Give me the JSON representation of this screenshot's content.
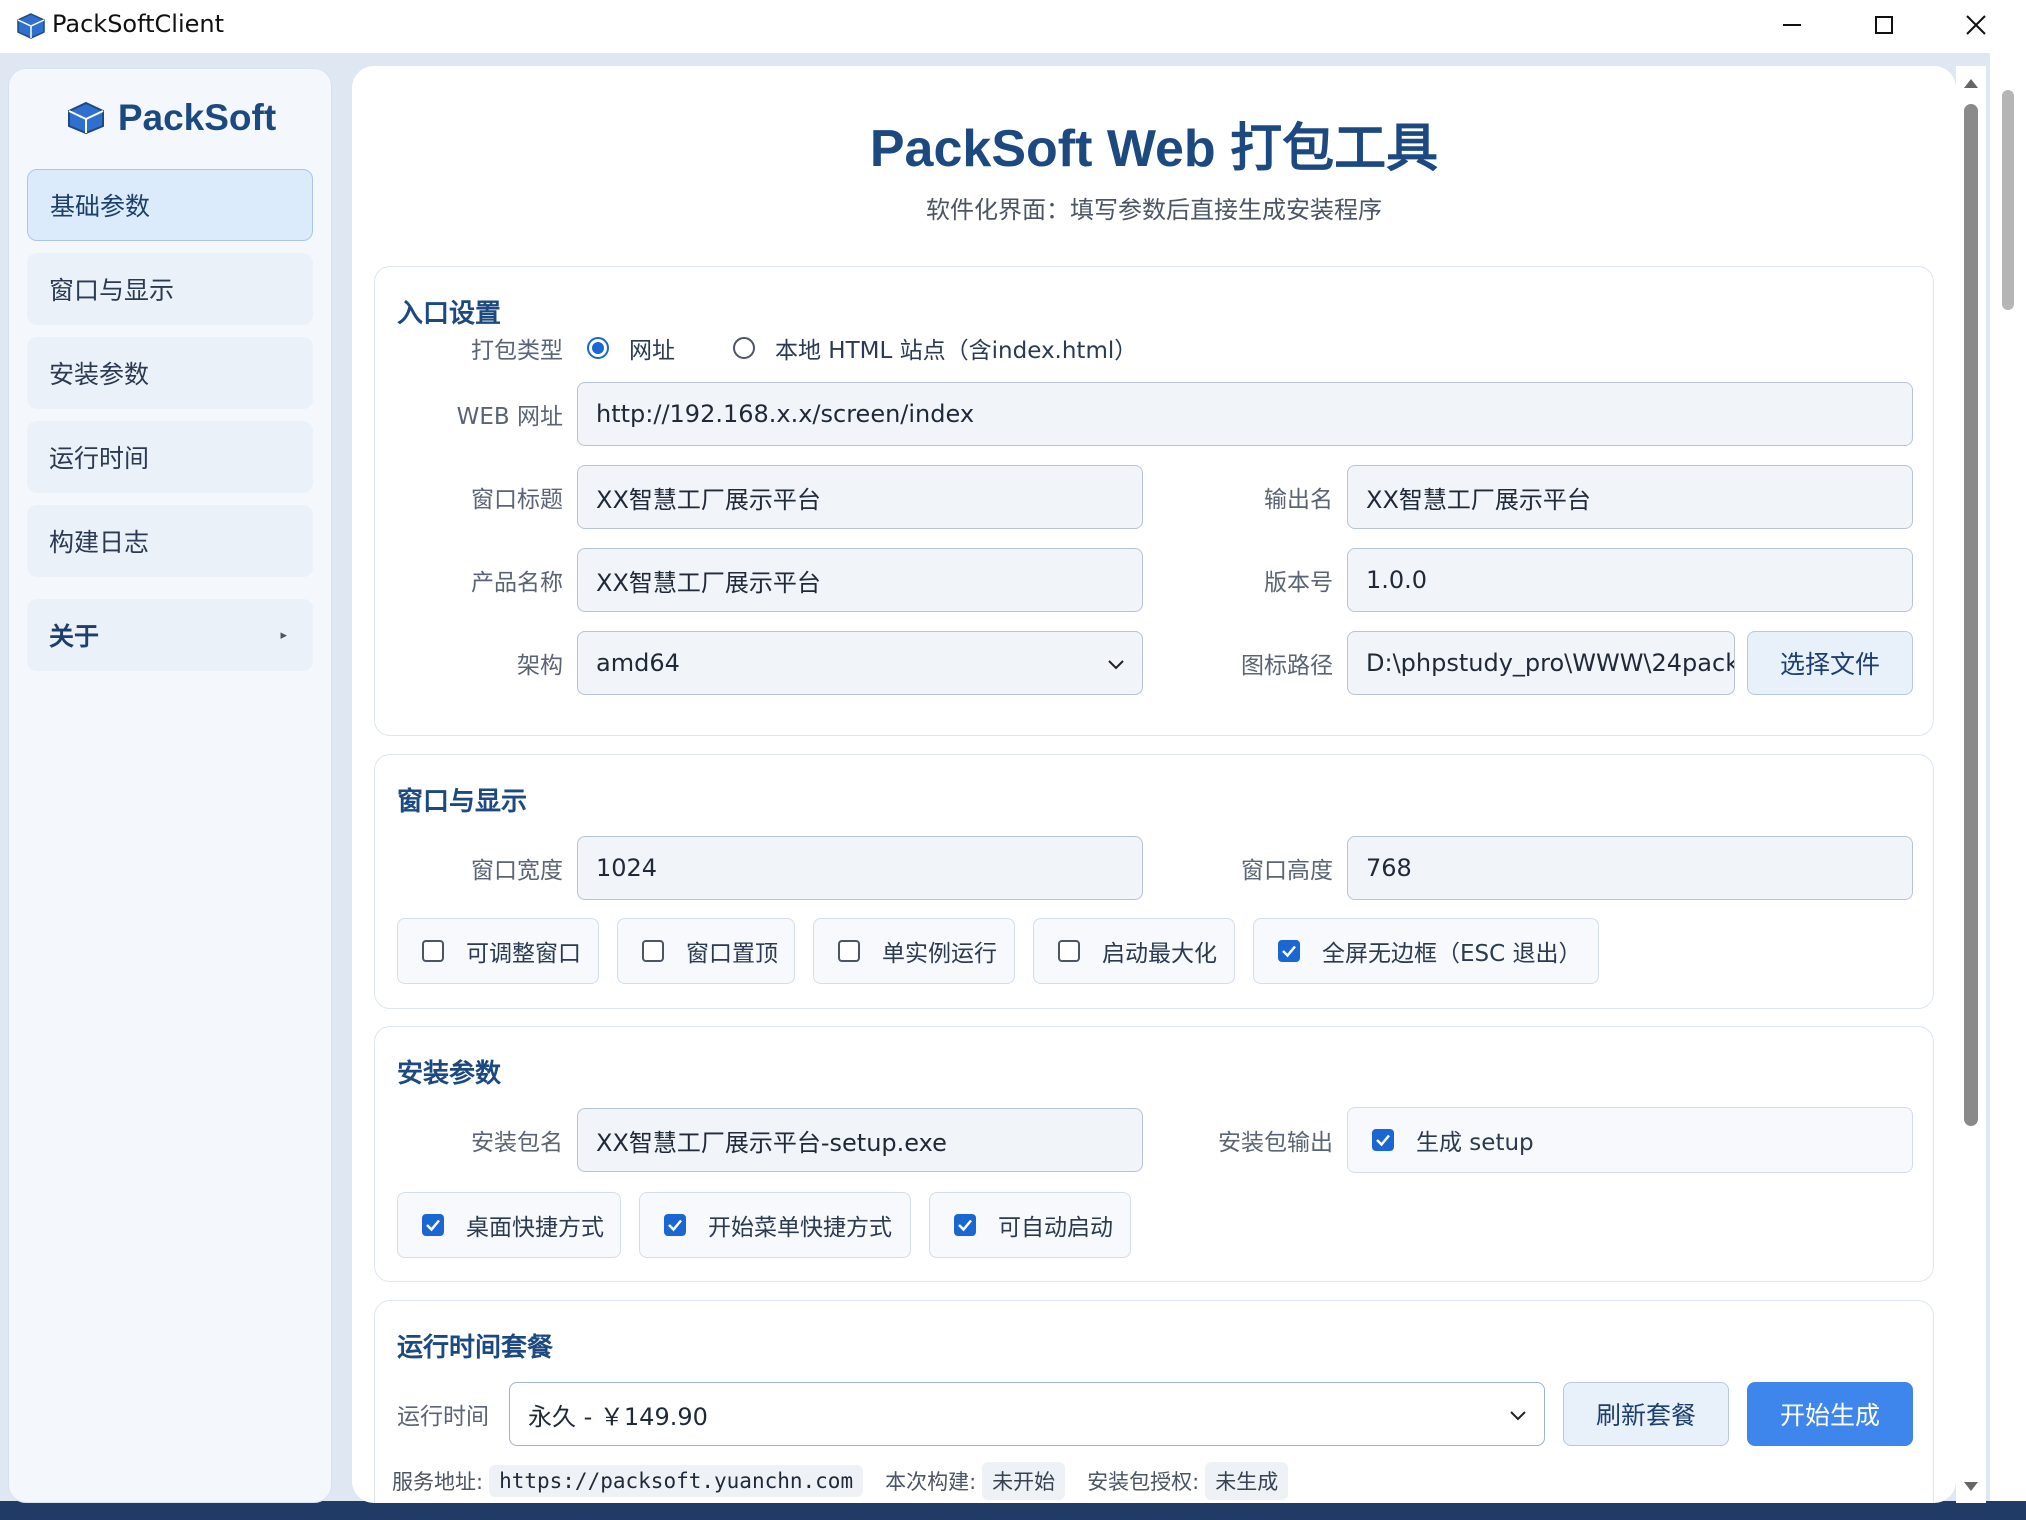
{
  "window": {
    "title": "PackSoftClient"
  },
  "sidebar": {
    "brand": "PackSoft",
    "items": [
      {
        "label": "基础参数"
      },
      {
        "label": "窗口与显示"
      },
      {
        "label": "安装参数"
      },
      {
        "label": "运行时间"
      },
      {
        "label": "构建日志"
      },
      {
        "label": "关于",
        "arrow": "▸"
      }
    ]
  },
  "header": {
    "title": "PackSoft Web 打包工具",
    "subtitle": "软件化界面：填写参数后直接生成安装程序"
  },
  "entry": {
    "section_title": "入口设置",
    "pack_type_label": "打包类型",
    "pack_type_options": [
      "网址",
      "本地 HTML 站点（含index.html）"
    ],
    "pack_type_selected": "网址",
    "url_label": "WEB 网址",
    "url_value": "http://192.168.x.x/screen/index",
    "window_title_label": "窗口标题",
    "window_title_value": "XX智慧工厂展示平台",
    "output_name_label": "输出名",
    "output_name_value": "XX智慧工厂展示平台",
    "product_name_label": "产品名称",
    "product_name_value": "XX智慧工厂展示平台",
    "version_label": "版本号",
    "version_value": "1.0.0",
    "arch_label": "架构",
    "arch_value": "amd64",
    "icon_path_label": "图标路径",
    "icon_path_value": "D:\\phpstudy_pro\\WWW\\24pack",
    "choose_file_button": "选择文件"
  },
  "display": {
    "section_title": "窗口与显示",
    "width_label": "窗口宽度",
    "width_value": "1024",
    "height_label": "窗口高度",
    "height_value": "768",
    "options": [
      {
        "label": "可调整窗口",
        "checked": false
      },
      {
        "label": "窗口置顶",
        "checked": false
      },
      {
        "label": "单实例运行",
        "checked": false
      },
      {
        "label": "启动最大化",
        "checked": false
      },
      {
        "label": "全屏无边框（ESC 退出）",
        "checked": true
      }
    ]
  },
  "install": {
    "section_title": "安装参数",
    "package_name_label": "安装包名",
    "package_name_value": "XX智慧工厂展示平台-setup.exe",
    "package_output_label": "安装包输出",
    "generate_setup_label": "生成 setup",
    "generate_setup_checked": true,
    "options": [
      {
        "label": "桌面快捷方式",
        "checked": true
      },
      {
        "label": "开始菜单快捷方式",
        "checked": true
      },
      {
        "label": "可自动启动",
        "checked": true
      }
    ]
  },
  "runtime": {
    "section_title": "运行时间套餐",
    "runtime_label": "运行时间",
    "plan_value": "永久 - ￥149.90",
    "refresh_button": "刷新套餐",
    "start_button": "开始生成",
    "service_label": "服务地址:",
    "service_value": "https://packsoft.yuanchn.com",
    "build_label": "本次构建:",
    "build_value": "未开始",
    "license_label": "安装包授权:",
    "license_value": "未生成"
  },
  "colors": {
    "brand": "#1c4a80",
    "primary_button": "#3f86ec",
    "checkbox": "#1a66d2"
  },
  "icons": [
    "packsoft-logo-icon",
    "minimize-icon",
    "maximize-icon",
    "close-icon",
    "chevron-down-icon",
    "checkmark-icon",
    "scroll-up-icon",
    "scroll-down-icon"
  ]
}
